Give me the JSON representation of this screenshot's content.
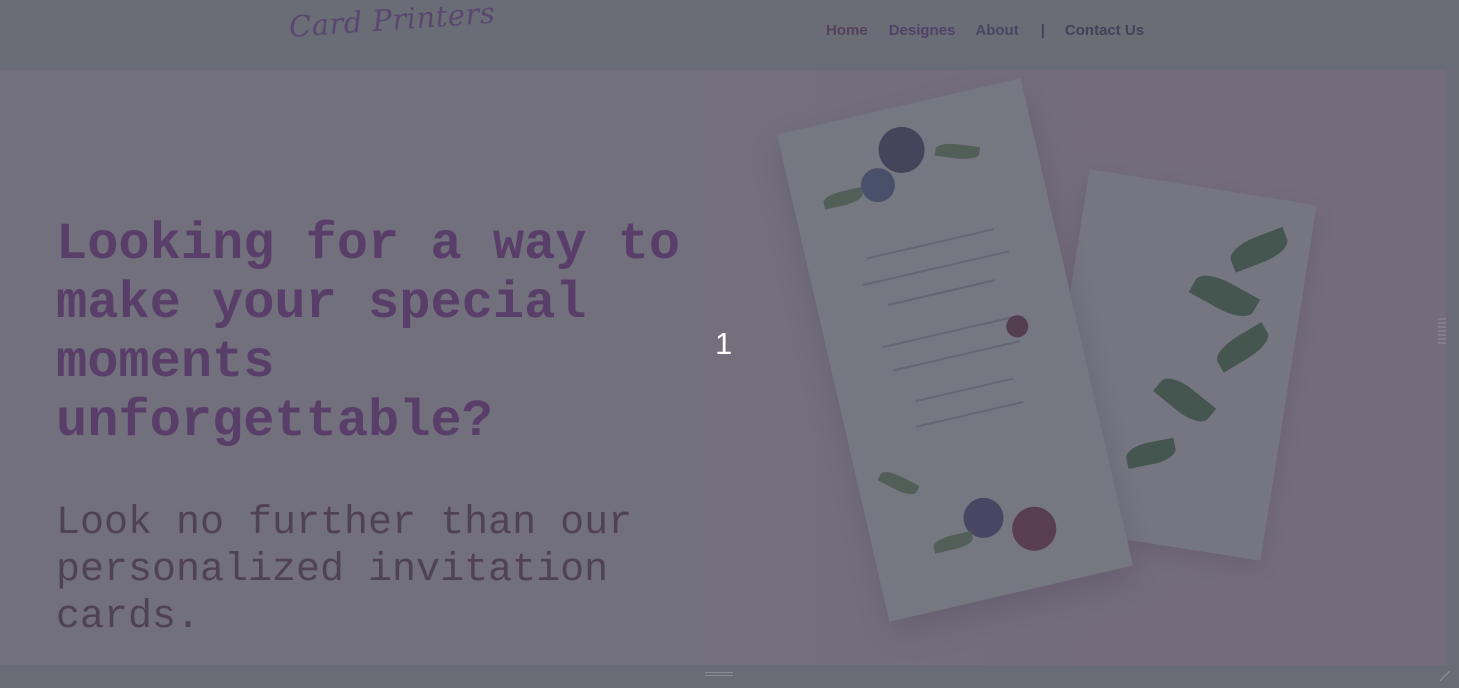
{
  "header": {
    "logo_text": "Card Printers",
    "nav": {
      "home": "Home",
      "designs": "Designes",
      "about": "About",
      "separator": "|",
      "contact": "Contact Us"
    }
  },
  "hero": {
    "title": "Looking for a way to make your special moments unforgettable?",
    "subtitle": "Look no further than our personalized invitation cards."
  },
  "overlay": {
    "index_label": "1"
  }
}
